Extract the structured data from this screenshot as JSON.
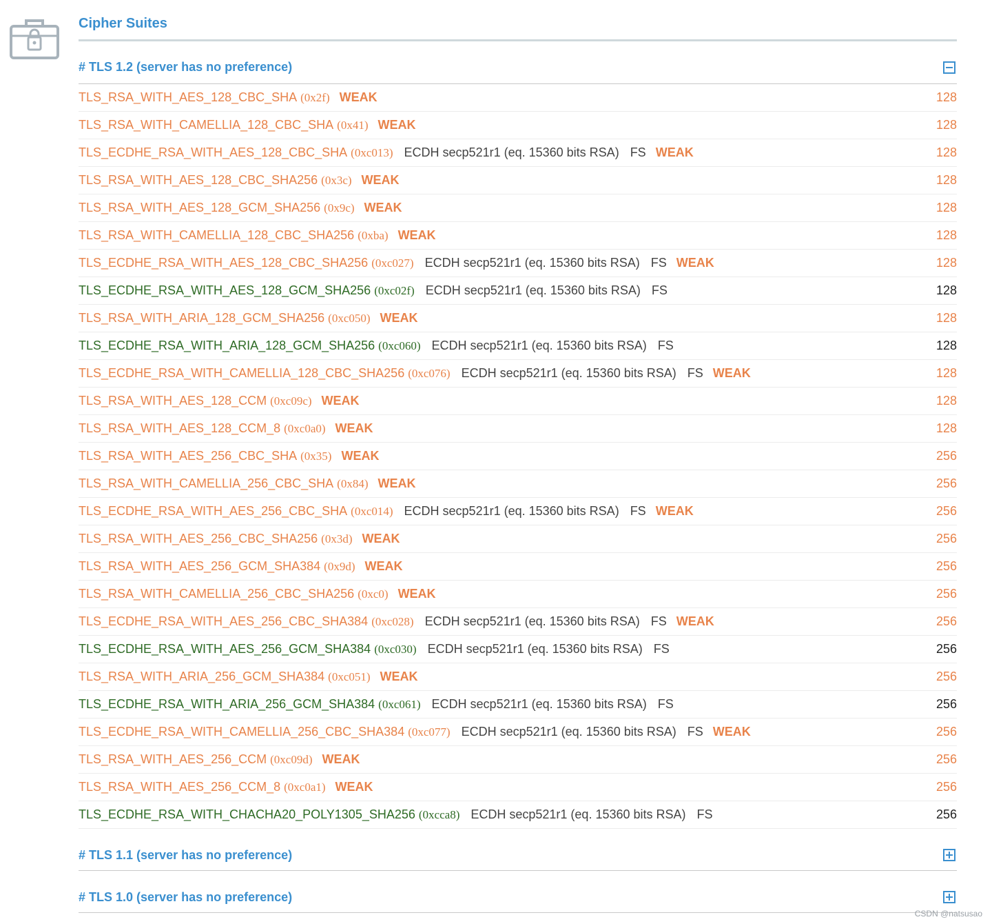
{
  "section": {
    "title": "Cipher Suites"
  },
  "protocols": [
    {
      "label": "# TLS 1.2 (server has no preference)",
      "expanded": true,
      "ciphers": [
        {
          "name": "TLS_RSA_WITH_AES_128_CBC_SHA",
          "code": "(0x2f)",
          "kex": "",
          "fs": "",
          "weak": "WEAK",
          "bits": "128",
          "status": "weak"
        },
        {
          "name": "TLS_RSA_WITH_CAMELLIA_128_CBC_SHA",
          "code": "(0x41)",
          "kex": "",
          "fs": "",
          "weak": "WEAK",
          "bits": "128",
          "status": "weak"
        },
        {
          "name": "TLS_ECDHE_RSA_WITH_AES_128_CBC_SHA",
          "code": "(0xc013)",
          "kex": "ECDH secp521r1 (eq. 15360 bits RSA)",
          "fs": "FS",
          "weak": "WEAK",
          "bits": "128",
          "status": "weak"
        },
        {
          "name": "TLS_RSA_WITH_AES_128_CBC_SHA256",
          "code": "(0x3c)",
          "kex": "",
          "fs": "",
          "weak": "WEAK",
          "bits": "128",
          "status": "weak"
        },
        {
          "name": "TLS_RSA_WITH_AES_128_GCM_SHA256",
          "code": "(0x9c)",
          "kex": "",
          "fs": "",
          "weak": "WEAK",
          "bits": "128",
          "status": "weak"
        },
        {
          "name": "TLS_RSA_WITH_CAMELLIA_128_CBC_SHA256",
          "code": "(0xba)",
          "kex": "",
          "fs": "",
          "weak": "WEAK",
          "bits": "128",
          "status": "weak"
        },
        {
          "name": "TLS_ECDHE_RSA_WITH_AES_128_CBC_SHA256",
          "code": "(0xc027)",
          "kex": "ECDH secp521r1 (eq. 15360 bits RSA)",
          "fs": "FS",
          "weak": "WEAK",
          "bits": "128",
          "status": "weak"
        },
        {
          "name": "TLS_ECDHE_RSA_WITH_AES_128_GCM_SHA256",
          "code": "(0xc02f)",
          "kex": "ECDH secp521r1 (eq. 15360 bits RSA)",
          "fs": "FS",
          "weak": "",
          "bits": "128",
          "status": "good"
        },
        {
          "name": "TLS_RSA_WITH_ARIA_128_GCM_SHA256",
          "code": "(0xc050)",
          "kex": "",
          "fs": "",
          "weak": "WEAK",
          "bits": "128",
          "status": "weak"
        },
        {
          "name": "TLS_ECDHE_RSA_WITH_ARIA_128_GCM_SHA256",
          "code": "(0xc060)",
          "kex": "ECDH secp521r1 (eq. 15360 bits RSA)",
          "fs": "FS",
          "weak": "",
          "bits": "128",
          "status": "good"
        },
        {
          "name": "TLS_ECDHE_RSA_WITH_CAMELLIA_128_CBC_SHA256",
          "code": "(0xc076)",
          "kex": "ECDH secp521r1 (eq. 15360 bits RSA)",
          "fs": "FS",
          "weak": "WEAK",
          "bits": "128",
          "status": "weak"
        },
        {
          "name": "TLS_RSA_WITH_AES_128_CCM",
          "code": "(0xc09c)",
          "kex": "",
          "fs": "",
          "weak": "WEAK",
          "bits": "128",
          "status": "weak"
        },
        {
          "name": "TLS_RSA_WITH_AES_128_CCM_8",
          "code": "(0xc0a0)",
          "kex": "",
          "fs": "",
          "weak": "WEAK",
          "bits": "128",
          "status": "weak"
        },
        {
          "name": "TLS_RSA_WITH_AES_256_CBC_SHA",
          "code": "(0x35)",
          "kex": "",
          "fs": "",
          "weak": "WEAK",
          "bits": "256",
          "status": "weak"
        },
        {
          "name": "TLS_RSA_WITH_CAMELLIA_256_CBC_SHA",
          "code": "(0x84)",
          "kex": "",
          "fs": "",
          "weak": "WEAK",
          "bits": "256",
          "status": "weak"
        },
        {
          "name": "TLS_ECDHE_RSA_WITH_AES_256_CBC_SHA",
          "code": "(0xc014)",
          "kex": "ECDH secp521r1 (eq. 15360 bits RSA)",
          "fs": "FS",
          "weak": "WEAK",
          "bits": "256",
          "status": "weak"
        },
        {
          "name": "TLS_RSA_WITH_AES_256_CBC_SHA256",
          "code": "(0x3d)",
          "kex": "",
          "fs": "",
          "weak": "WEAK",
          "bits": "256",
          "status": "weak"
        },
        {
          "name": "TLS_RSA_WITH_AES_256_GCM_SHA384",
          "code": "(0x9d)",
          "kex": "",
          "fs": "",
          "weak": "WEAK",
          "bits": "256",
          "status": "weak"
        },
        {
          "name": "TLS_RSA_WITH_CAMELLIA_256_CBC_SHA256",
          "code": "(0xc0)",
          "kex": "",
          "fs": "",
          "weak": "WEAK",
          "bits": "256",
          "status": "weak"
        },
        {
          "name": "TLS_ECDHE_RSA_WITH_AES_256_CBC_SHA384",
          "code": "(0xc028)",
          "kex": "ECDH secp521r1 (eq. 15360 bits RSA)",
          "fs": "FS",
          "weak": "WEAK",
          "bits": "256",
          "status": "weak"
        },
        {
          "name": "TLS_ECDHE_RSA_WITH_AES_256_GCM_SHA384",
          "code": "(0xc030)",
          "kex": "ECDH secp521r1 (eq. 15360 bits RSA)",
          "fs": "FS",
          "weak": "",
          "bits": "256",
          "status": "good"
        },
        {
          "name": "TLS_RSA_WITH_ARIA_256_GCM_SHA384",
          "code": "(0xc051)",
          "kex": "",
          "fs": "",
          "weak": "WEAK",
          "bits": "256",
          "status": "weak"
        },
        {
          "name": "TLS_ECDHE_RSA_WITH_ARIA_256_GCM_SHA384",
          "code": "(0xc061)",
          "kex": "ECDH secp521r1 (eq. 15360 bits RSA)",
          "fs": "FS",
          "weak": "",
          "bits": "256",
          "status": "good"
        },
        {
          "name": "TLS_ECDHE_RSA_WITH_CAMELLIA_256_CBC_SHA384",
          "code": "(0xc077)",
          "kex": "ECDH secp521r1 (eq. 15360 bits RSA)",
          "fs": "FS",
          "weak": "WEAK",
          "bits": "256",
          "status": "weak"
        },
        {
          "name": "TLS_RSA_WITH_AES_256_CCM",
          "code": "(0xc09d)",
          "kex": "",
          "fs": "",
          "weak": "WEAK",
          "bits": "256",
          "status": "weak"
        },
        {
          "name": "TLS_RSA_WITH_AES_256_CCM_8",
          "code": "(0xc0a1)",
          "kex": "",
          "fs": "",
          "weak": "WEAK",
          "bits": "256",
          "status": "weak"
        },
        {
          "name": "TLS_ECDHE_RSA_WITH_CHACHA20_POLY1305_SHA256",
          "code": "(0xcca8)",
          "kex": "ECDH secp521r1 (eq. 15360 bits RSA)",
          "fs": "FS",
          "weak": "",
          "bits": "256",
          "status": "good"
        }
      ]
    },
    {
      "label": "# TLS 1.1 (server has no preference)",
      "expanded": false,
      "ciphers": []
    },
    {
      "label": "# TLS 1.0 (server has no preference)",
      "expanded": false,
      "ciphers": []
    }
  ],
  "icons": {
    "section_icon": "lock-briefcase-icon",
    "collapse": "minus-square-icon",
    "expand": "plus-square-icon"
  },
  "colors": {
    "accent": "#3a8fcf",
    "weak": "#e8834a",
    "good": "#2e6b25"
  },
  "watermark": "CSDN @natsusao"
}
